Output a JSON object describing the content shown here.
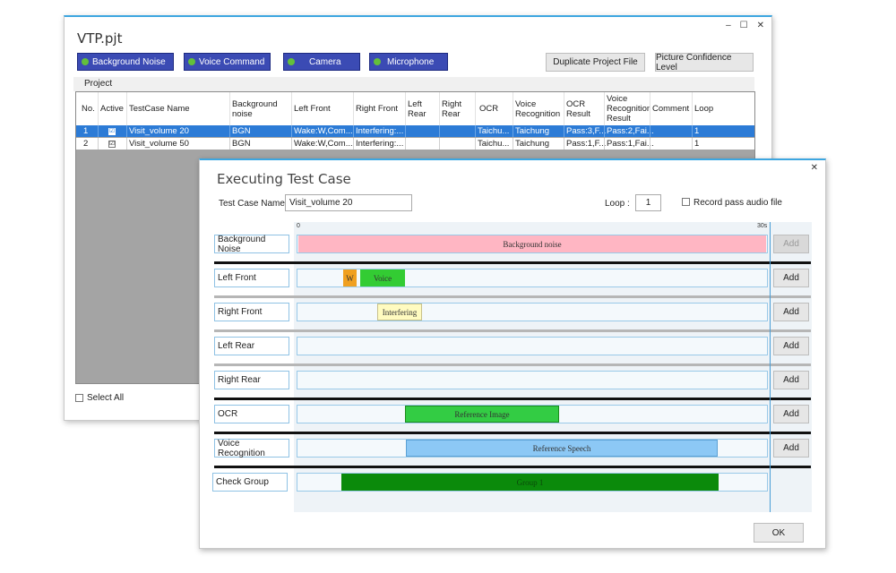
{
  "back_window": {
    "title": "VTP.pjt",
    "controls": {
      "minimize": "‒",
      "maximize": "☐",
      "close": "✕"
    },
    "signal_buttons": [
      "Background Noise",
      "Voice Command",
      "Camera",
      "Microphone"
    ],
    "duplicate_label": "Duplicate Project File",
    "confidence_label": "Picture Confidence Level",
    "project_label": "Project",
    "columns": [
      "No.",
      "Active",
      "TestCase Name",
      "Background noise",
      "Left Front",
      "Right Front",
      "Left Rear",
      "Right Rear",
      "OCR",
      "Voice Recognition",
      "OCR Result",
      "Voice Recognition Result",
      "Comment",
      "Loop"
    ],
    "rows": [
      {
        "no": "1",
        "active": "☑",
        "name": "Visit_volume 20",
        "bg": "BGN",
        "lf": "Wake:W,Com...",
        "rf": "Interfering:...",
        "lr": "",
        "rr": "",
        "ocr": "Taichu...",
        "vr": "Taichung",
        "ocr_result": "Pass:3,F...",
        "vr_result": "Pass:2,Fai...",
        "comment": "",
        "loop": "1"
      },
      {
        "no": "2",
        "active": "☑",
        "name": "Visit_volume 50",
        "bg": "BGN",
        "lf": "Wake:W,Com...",
        "rf": "Interfering:...",
        "lr": "",
        "rr": "",
        "ocr": "Taichu...",
        "vr": "Taichung",
        "ocr_result": "Pass:1,F...",
        "vr_result": "Pass:1,Fai...",
        "comment": "",
        "loop": "1"
      }
    ],
    "select_all_label": "Select All"
  },
  "dialog": {
    "title": "Executing Test Case",
    "close": "✕",
    "testcase_label": "Test Case Name :",
    "testcase_value": "Visit_volume 20",
    "loop_label": "Loop :",
    "loop_value": "1",
    "record_label": "Record pass audio file",
    "timeline_start": "0",
    "timeline_end": "30s",
    "add_label": "Add",
    "ok_label": "OK",
    "rows": [
      {
        "label": "Background Noise",
        "clips": [
          {
            "text": "Background noise"
          }
        ]
      },
      {
        "label": "Left Front",
        "clips": [
          {
            "text": "W"
          },
          {
            "text": "Voice"
          }
        ]
      },
      {
        "label": "Right Front",
        "clips": [
          {
            "text": "Interfering"
          }
        ]
      },
      {
        "label": "Left Rear",
        "clips": []
      },
      {
        "label": "Right Rear",
        "clips": []
      },
      {
        "label": "OCR",
        "clips": [
          {
            "text": "Reference Image"
          }
        ]
      },
      {
        "label": "Voice Recognition",
        "clips": [
          {
            "text": "Reference Speech"
          }
        ]
      },
      {
        "label": "Check Group",
        "clips": [
          {
            "text": "Group 1"
          }
        ]
      }
    ]
  },
  "colors": {
    "accent": "#3da6e0",
    "signal_button": "#3b4bb4",
    "selected_row": "#2c7bd6",
    "bg_noise_clip": "#ffb6c3",
    "wake_clip": "#f0a020",
    "voice_clip": "#33cc33",
    "interfering_clip": "#fffbc0",
    "ocr_clip": "#33cc44",
    "speech_clip": "#8cc8f5",
    "group_clip": "#0b8a0b"
  }
}
